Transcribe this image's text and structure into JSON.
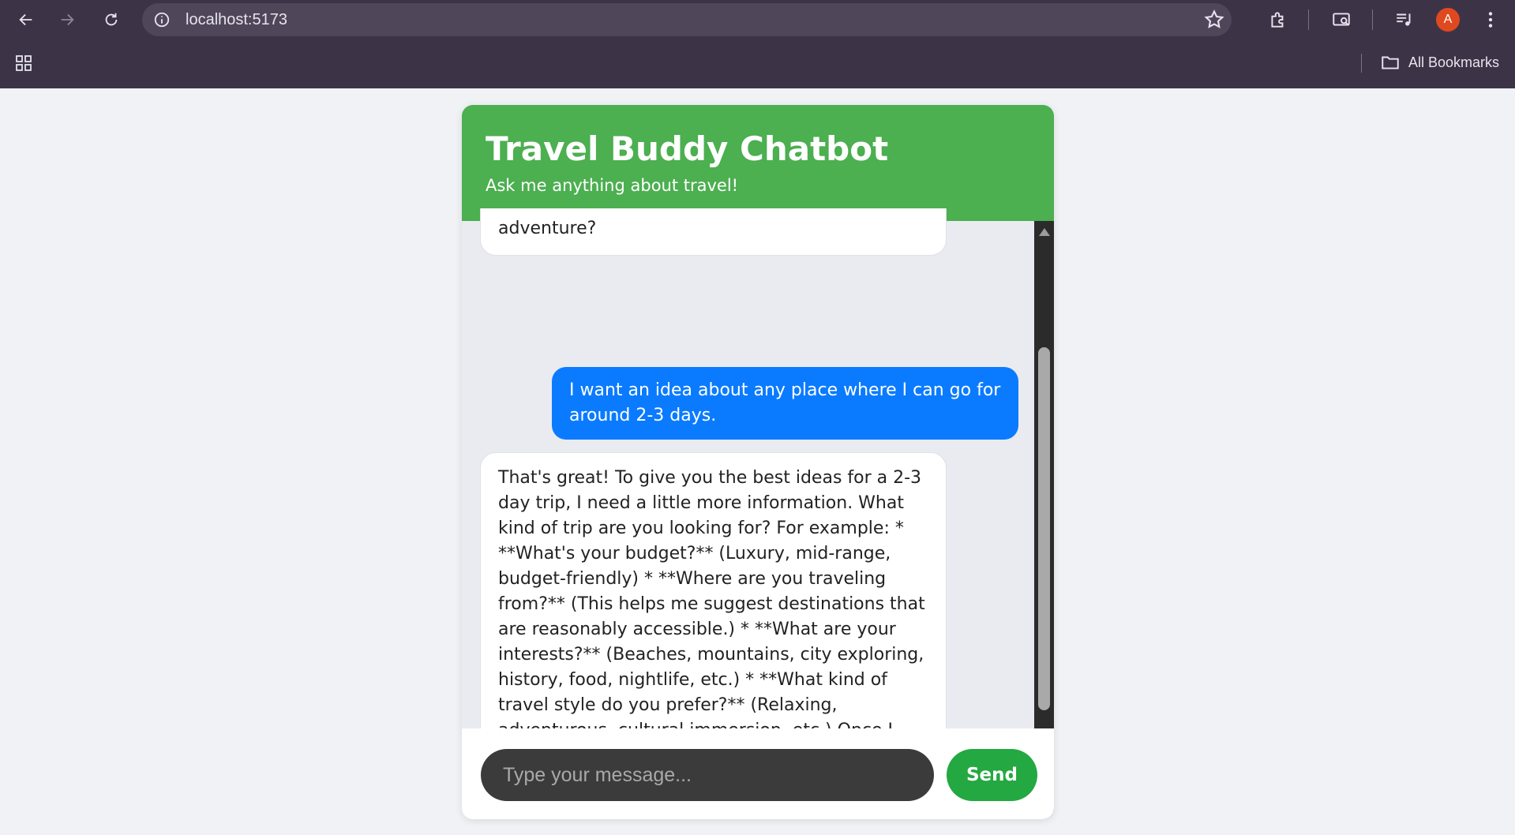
{
  "browser": {
    "url": "localhost:5173",
    "profile_initial": "A",
    "bookmarks_label": "All Bookmarks"
  },
  "chat": {
    "title": "Travel Buddy Chatbot",
    "subtitle": "Ask me anything about travel!",
    "messages": [
      {
        "role": "bot",
        "text": "adventure?"
      },
      {
        "role": "user",
        "text": "I want an idea about any place where I can go for around 2-3 days."
      },
      {
        "role": "bot",
        "text": "That's great! To give you the best ideas for a 2-3 day trip, I need a little more information. What kind of trip are you looking for? For example: * **What's your budget?** (Luxury, mid-range, budget-friendly) * **Where are you traveling from?** (This helps me suggest destinations that are reasonably accessible.) * **What are your interests?** (Beaches, mountains, city exploring, history, food, nightlife, etc.) * **What kind of travel style do you prefer?** (Relaxing, adventurous, cultural immersion, etc.) Once I have a better understanding of your preferences, I can suggest some perfect destinations for your short getaway!"
      }
    ],
    "input_placeholder": "Type your message...",
    "send_label": "Send"
  },
  "colors": {
    "header": "#4caf50",
    "user_bubble": "#0a7bff",
    "send_button": "#24a841"
  }
}
